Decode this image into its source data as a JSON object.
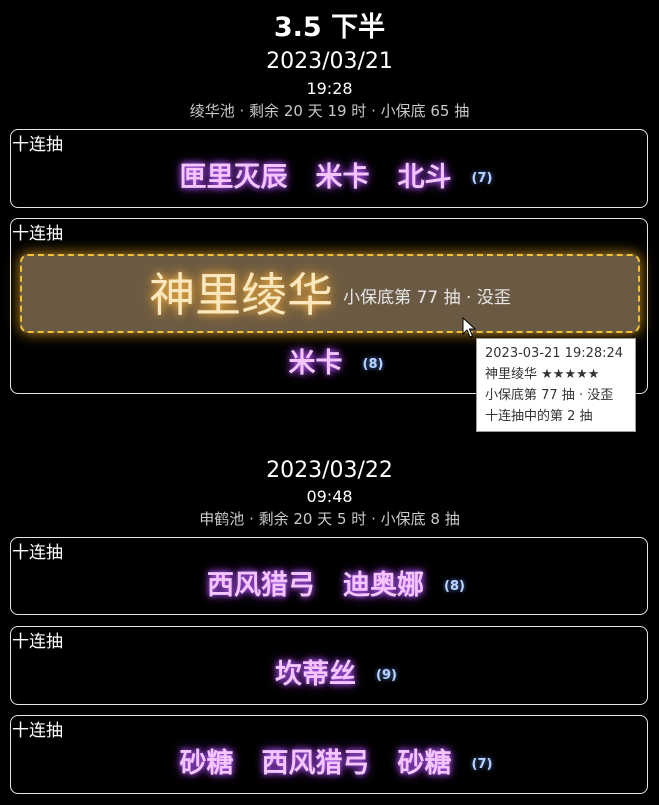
{
  "header": {
    "title": "3.5 下半"
  },
  "sections": [
    {
      "date": "2023/03/21",
      "time": "19:28",
      "info": "绫华池 · 剩余 20 天 19 时 · 小保底 65 抽",
      "cards": [
        {
          "label": "十连抽",
          "rows": [
            {
              "names": [
                "匣里灭辰",
                "米卡",
                "北斗"
              ],
              "count": "(7)"
            }
          ]
        },
        {
          "label": "十连抽",
          "five_star": {
            "name": "神里绫华",
            "note": "小保底第 77 抽 · 没歪"
          },
          "rows": [
            {
              "names": [
                "米卡"
              ],
              "count": "(8)"
            }
          ]
        }
      ]
    },
    {
      "date": "2023/03/22",
      "time": "09:48",
      "info": "申鹤池 · 剩余 20 天 5 时 · 小保底 8 抽",
      "cards": [
        {
          "label": "十连抽",
          "rows": [
            {
              "names": [
                "西风猎弓",
                "迪奥娜"
              ],
              "count": "(8)"
            }
          ]
        },
        {
          "label": "十连抽",
          "rows": [
            {
              "names": [
                "坎蒂丝"
              ],
              "count": "(9)"
            }
          ]
        },
        {
          "label": "十连抽",
          "rows": [
            {
              "names": [
                "砂糖",
                "西风猎弓",
                "砂糖"
              ],
              "count": "(7)"
            }
          ]
        }
      ]
    }
  ],
  "tooltip": {
    "timestamp": "2023-03-21 19:28:24",
    "item": "神里绫华 ★★★★★",
    "pity": "小保底第 77 抽 · 没歪",
    "position": "十连抽中的第 2 抽"
  },
  "colors": {
    "four_star": "#f3c6ff",
    "five_star": "#fde8bd",
    "highlight_border": "#f2c230",
    "count": "#b9d4ff"
  }
}
